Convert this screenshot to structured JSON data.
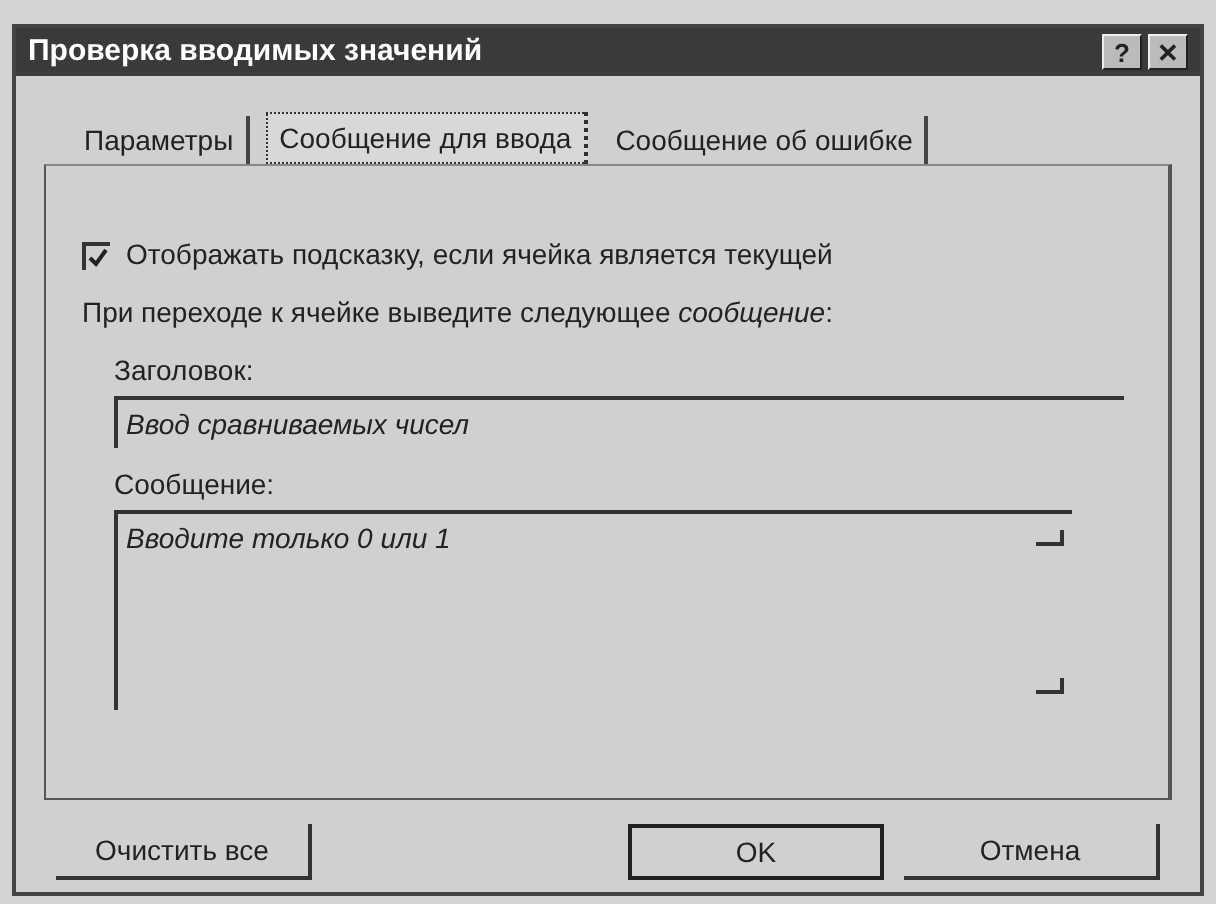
{
  "window": {
    "title": "Проверка вводимых значений",
    "controls": [
      "?",
      "✕"
    ]
  },
  "tabs": [
    {
      "label": "Параметры",
      "selected": false
    },
    {
      "label": "Сообщение для ввода",
      "selected": true
    },
    {
      "label": "Сообщение об ошибке",
      "selected": false
    }
  ],
  "show_hint": {
    "label": "Отображать подсказку, если ячейка является текущей",
    "checked": true
  },
  "instruction": "При переходе к ячейке выведите следующее *сообщение*:",
  "title_field": {
    "label": "Заголовок:",
    "value": "Ввод сравниваемых чисел"
  },
  "message_field": {
    "label": "Сообщение:",
    "value": "Вводите только 0 или 1"
  },
  "buttons": [
    {
      "label": "Очистить все",
      "kind": "left",
      "default": false
    },
    {
      "label": "OK",
      "kind": "right",
      "default": true
    },
    {
      "label": "Отмена",
      "kind": "right",
      "default": false
    }
  ]
}
